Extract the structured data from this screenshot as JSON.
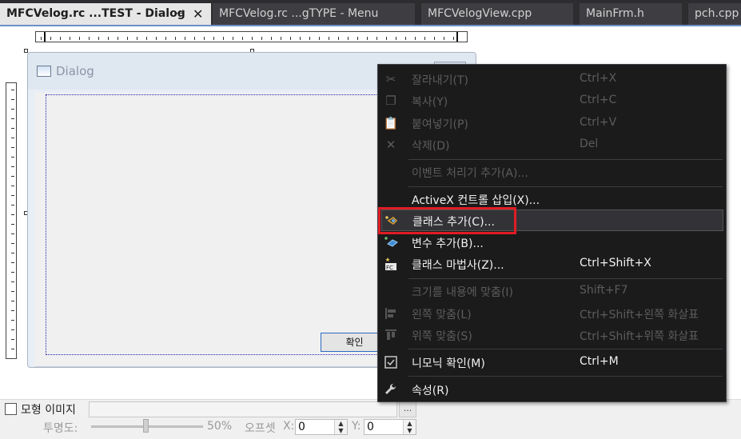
{
  "tabs": [
    {
      "label": "MFCVelog.rc ...TEST - Dialog",
      "pin": "⊣",
      "close": "✕"
    },
    {
      "label": "MFCVelog.rc ...gTYPE - Menu"
    },
    {
      "label": "MFCVelogView.cpp"
    },
    {
      "label": "MainFrm.h"
    },
    {
      "label": "pch.cpp"
    }
  ],
  "dialog": {
    "title": "Dialog",
    "ok_label": "확인"
  },
  "props": {
    "modal_image_label": "모형 이미지",
    "browse": "...",
    "opacity_label": "투명도:",
    "opacity_value": 0.5,
    "opacity_text": "50%",
    "offset_label": "오프셋",
    "x_label": "X:",
    "x_value": "0",
    "y_label": "Y:",
    "y_value": "0"
  },
  "menu": {
    "items": [
      {
        "label": "잘라내기(T)",
        "shortcut": "Ctrl+X",
        "icon": "scissors-icon",
        "enabled": false
      },
      {
        "label": "복사(Y)",
        "shortcut": "Ctrl+C",
        "icon": "copy-icon",
        "enabled": false
      },
      {
        "label": "붙여넣기(P)",
        "shortcut": "Ctrl+V",
        "icon": "paste-icon",
        "enabled": false
      },
      {
        "label": "삭제(D)",
        "shortcut": "Del",
        "icon": "delete-icon",
        "enabled": false
      },
      {
        "label": "이벤트 처리기 추가(A)...",
        "shortcut": "",
        "icon": "",
        "enabled": false
      },
      {
        "label": "ActiveX 컨트롤 삽입(X)...",
        "shortcut": "",
        "icon": "",
        "enabled": true
      },
      {
        "label": "클래스 추가(C)...",
        "shortcut": "",
        "icon": "add-class-icon",
        "enabled": true,
        "highlighted": true
      },
      {
        "label": "변수 추가(B)...",
        "shortcut": "",
        "icon": "add-variable-icon",
        "enabled": true
      },
      {
        "label": "클래스 마법사(Z)...",
        "shortcut": "Ctrl+Shift+X",
        "icon": "class-wizard-icon",
        "enabled": true
      },
      {
        "label": "크기를 내용에 맞춤(I)",
        "shortcut": "Shift+F7",
        "icon": "",
        "enabled": false
      },
      {
        "label": "왼쪽 맞춤(L)",
        "shortcut": "Ctrl+Shift+왼쪽 화살표",
        "icon": "align-left-icon",
        "enabled": false
      },
      {
        "label": "위쪽 맞춤(S)",
        "shortcut": "Ctrl+Shift+위쪽 화살표",
        "icon": "align-top-icon",
        "enabled": false
      },
      {
        "label": "니모닉 확인(M)",
        "shortcut": "Ctrl+M",
        "icon": "checkbox-icon",
        "enabled": true
      },
      {
        "label": "속성(R)",
        "shortcut": "",
        "icon": "wrench-icon",
        "enabled": true
      }
    ]
  },
  "colors": {
    "menu_bg": "#1b1b1c",
    "highlight_box": "#e01c24",
    "active_tab_underline": "#6e8fc7"
  }
}
